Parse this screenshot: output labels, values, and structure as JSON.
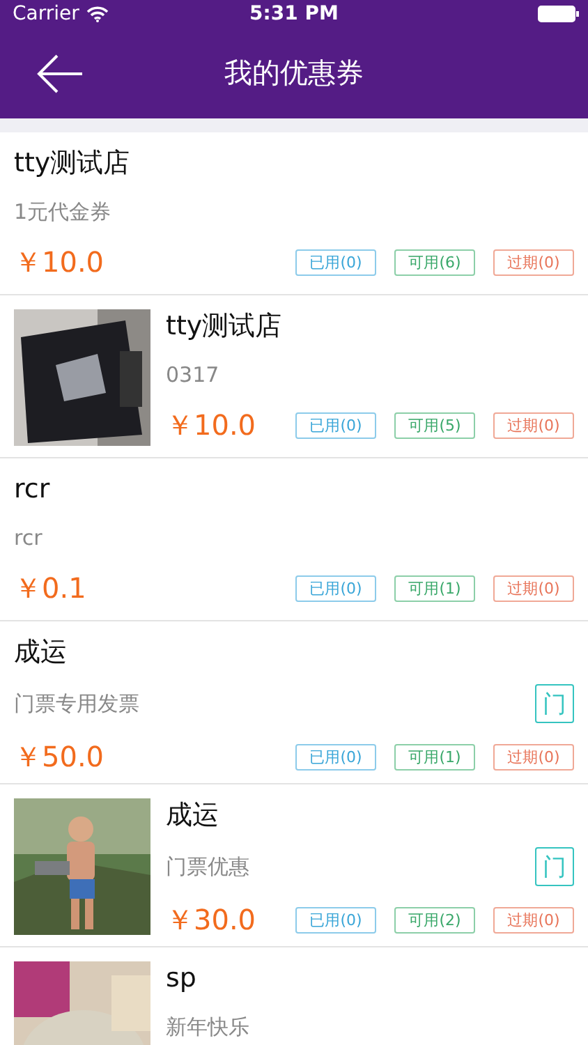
{
  "status_bar": {
    "carrier": "Carrier",
    "time": "5:31 PM"
  },
  "nav": {
    "title": "我的优惠券"
  },
  "coupons": [
    {
      "image": false,
      "store": "tty测试店",
      "name": "1元代金券",
      "price": "￥10.0",
      "used": "已用(0)",
      "available": "可用(6)",
      "expired": "过期(0)"
    },
    {
      "image": true,
      "store": "tty测试店",
      "name": "0317",
      "price": "￥10.0",
      "used": "已用(0)",
      "available": "可用(5)",
      "expired": "过期(0)"
    },
    {
      "image": false,
      "store": "rcr",
      "name": "rcr",
      "price": "￥0.1",
      "used": "已用(0)",
      "available": "可用(1)",
      "expired": "过期(0)"
    },
    {
      "image": false,
      "store": "成运",
      "name": "门票专用发票",
      "price": "￥50.0",
      "tag": "门",
      "used": "已用(0)",
      "available": "可用(1)",
      "expired": "过期(0)"
    },
    {
      "image": true,
      "store": "成运",
      "name": "门票优惠",
      "price": "￥30.0",
      "tag": "门",
      "used": "已用(0)",
      "available": "可用(2)",
      "expired": "过期(0)"
    },
    {
      "image": true,
      "store": "sp",
      "name": "新年快乐"
    }
  ]
}
